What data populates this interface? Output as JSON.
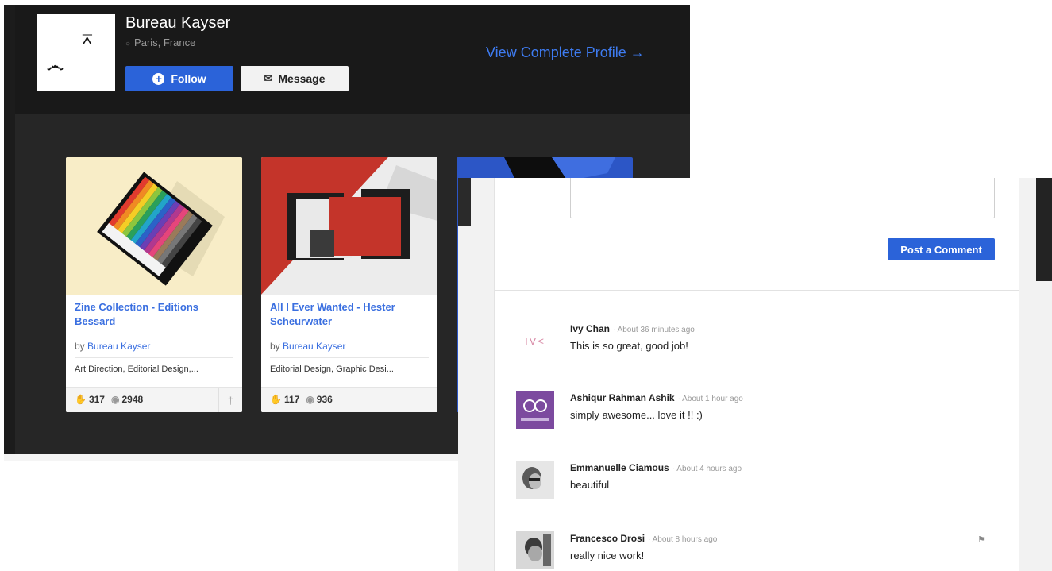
{
  "profile": {
    "name": "Bureau Kayser",
    "location": "Paris, France",
    "follow_label": "Follow",
    "message_label": "Message",
    "view_profile_label": "View Complete Profile →"
  },
  "projects": [
    {
      "title": "Zine Collection - Editions Bessard",
      "by_prefix": "by",
      "author": "Bureau Kayser",
      "fields": "Art Direction, Editorial Design,...",
      "appreciations": "317",
      "views": "2948"
    },
    {
      "title": "All I Ever Wanted - Hester Scheurwater",
      "by_prefix": "by",
      "author": "Bureau Kayser",
      "fields": "Editorial Design, Graphic Desi...",
      "appreciations": "117",
      "views": "936"
    }
  ],
  "comments_panel": {
    "post_label": "Post a Comment",
    "comments": [
      {
        "author": "Ivy Chan",
        "time": "· About 36 minutes ago",
        "text": "This is so great, good job!",
        "avatar_text": "IV<"
      },
      {
        "author": "Ashiqur Rahman Ashik",
        "time": "· About 1 hour ago",
        "text": "simply awesome... love it !! :)"
      },
      {
        "author": "Emmanuelle Ciamous",
        "time": "· About 4 hours ago",
        "text": "beautiful"
      },
      {
        "author": "Francesco Drosi",
        "time": "· About 8 hours ago",
        "text": "really nice work!"
      }
    ]
  },
  "icons": {
    "location": "map-pin-icon",
    "follow": "plus-circle-icon",
    "message": "envelope-icon",
    "appreciate": "thumbs-up-icon",
    "views": "eye-icon",
    "pin": "pin-icon",
    "flag": "flag-icon"
  },
  "colors": {
    "accent": "#2b63d9",
    "link": "#3a6fe0",
    "dark_panel": "#191919",
    "avatar_purple": "#7c4a9f"
  }
}
